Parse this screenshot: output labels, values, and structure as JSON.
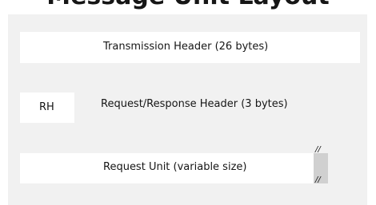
{
  "title": "Message Unit Layout",
  "blocks": {
    "transmission_header": "Transmission Header (26 bytes)",
    "rh_label": "RH",
    "request_response_header": "Request/Response Header (3 bytes)",
    "request_unit": "Request Unit (variable size)"
  },
  "break_marks": {
    "top": "//",
    "bottom": "//"
  },
  "colors": {
    "panel_background": "#f1f1f1",
    "box_background": "#ffffff",
    "break_marker": "#d0d0d0",
    "text": "#161616"
  }
}
